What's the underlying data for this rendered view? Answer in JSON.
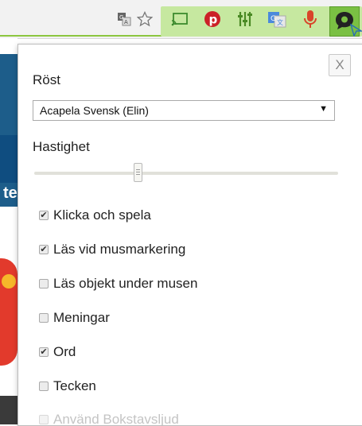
{
  "toolbar": {
    "icons": [
      "translate-icon",
      "bookmark-star-icon",
      "cast-icon",
      "pinterest-icon",
      "equalizer-icon",
      "google-translate-icon",
      "microphone-icon",
      "speech-reader-icon"
    ],
    "accent_color": "#8cc63f"
  },
  "popup": {
    "close_label": "X",
    "voice_label": "Röst",
    "voice_selected": "Acapela Svensk (Elin)",
    "speed_label": "Hastighet",
    "speed_value": 0.34,
    "options": [
      {
        "label": "Klicka och spela",
        "checked": true,
        "enabled": true
      },
      {
        "label": "Läs vid musmarkering",
        "checked": true,
        "enabled": true
      },
      {
        "label": "Läs objekt under musen",
        "checked": false,
        "enabled": true
      },
      {
        "label": "Meningar",
        "checked": false,
        "enabled": true
      },
      {
        "label": "Ord",
        "checked": true,
        "enabled": true
      },
      {
        "label": "Tecken",
        "checked": false,
        "enabled": true
      },
      {
        "label": "Använd Bokstavsljud",
        "checked": false,
        "enabled": false
      }
    ]
  },
  "background": {
    "fragment_text": "te"
  }
}
